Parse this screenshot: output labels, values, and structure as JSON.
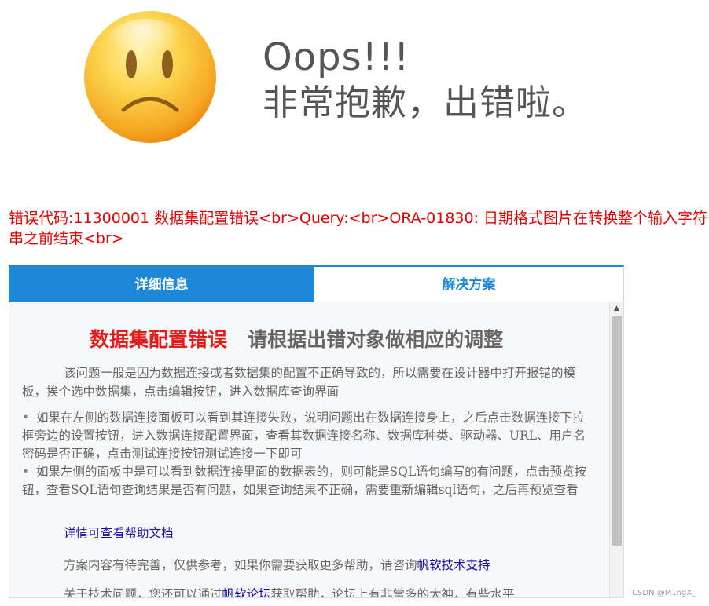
{
  "header": {
    "title_line1": "Oops!!!",
    "title_line2": "非常抱歉，出错啦。"
  },
  "error": {
    "message": "错误代码:11300001 数据集配置错误<br>Query:<br>ORA-01830: 日期格式图片在转换整个输入字符串之前结束<br>"
  },
  "tabs": {
    "detail": "详细信息",
    "solution": "解决方案"
  },
  "solution": {
    "heading_red": "数据集配置错误",
    "heading_gray": "请根据出错对象做相应的调整",
    "paragraph": "该问题一般是因为数据连接或者数据集的配置不正确导致的，所以需要在设计器中打开报错的模板，挨个选中数据集，点击编辑按钮，进入数据库查询界面",
    "items": [
      "如果在左侧的数据连接面板可以看到其连接失败，说明问题出在数据连接身上，之后点击数据连接下拉框旁边的设置按钮，进入数据连接配置界面，查看其数据连接名称、数据库种类、驱动器、URL、用户名密码是否正确，点击测试连接按钮测试连接一下即可",
      "如果左侧的面板中是可以看到数据连接里面的数据表的，则可能是SQL语句编写的有问题，点击预览按钮，查看SQL语句查询结果是否有问题，如果查询结果不正确，需要重新编辑sql语句，之后再预览查看"
    ],
    "help_link": "详情可查看帮助文档",
    "note_text": "方案内容有待完善，仅供参考，如果你需要获取更多帮助，请咨询",
    "support_link": "帆软技术支持",
    "note2_text": "关于技术问题，您还可以通过",
    "forum_link": "帆软论坛",
    "note2_rest": "获取帮助，论坛上有非常多的大神，有些水平"
  },
  "watermark": "CSDN @M1ngX_",
  "icons": {
    "face": "sad-face-icon",
    "scroll_up": "scroll-up-arrow-icon"
  },
  "colors": {
    "error_red": "#e60000",
    "tab_blue": "#1e88d8",
    "heading_red": "#e81b1b"
  }
}
